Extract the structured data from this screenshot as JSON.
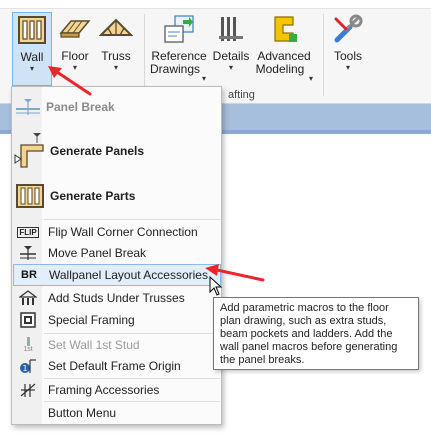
{
  "ribbon": {
    "buttons": [
      {
        "label": "Wall",
        "caret": "▾"
      },
      {
        "label": "Floor",
        "caret": "▾"
      },
      {
        "label": "Truss",
        "caret": "▾"
      },
      {
        "label": "Reference",
        "label2": "Drawings",
        "caret": "▾"
      },
      {
        "label": "Details",
        "caret": "▾"
      },
      {
        "label": "Advanced",
        "label2": "Modeling",
        "caret": "▾"
      },
      {
        "label": "Tools",
        "caret": "▾"
      }
    ],
    "group_label": "afting"
  },
  "menu": {
    "items": [
      {
        "label": "Panel Break",
        "icon": "panel-break-icon",
        "disabled": true
      },
      {
        "label": "Generate Panels",
        "icon": "generate-panels-icon"
      },
      {
        "label": "Generate Parts",
        "icon": "generate-parts-icon"
      },
      {
        "label": "Flip Wall Corner Connection",
        "icon": "flip-icon",
        "icon_text": "FLIP"
      },
      {
        "label": "Move Panel Break",
        "icon": "move-panel-break-icon"
      },
      {
        "label": "Wallpanel Layout Accessories",
        "icon": "br-icon",
        "icon_text": "BR"
      },
      {
        "label": "Add Studs Under Trusses",
        "icon": "studs-under-trusses-icon"
      },
      {
        "label": "Special Framing",
        "icon": "special-framing-icon"
      },
      {
        "label": "Set Wall 1st Stud",
        "icon": "first-stud-icon",
        "icon_text": "1st",
        "disabled": true
      },
      {
        "label": "Set Default Frame Origin",
        "icon": "frame-origin-icon"
      },
      {
        "label": "Framing Accessories",
        "icon": "framing-accessories-icon"
      },
      {
        "label": "Button Menu",
        "icon": ""
      }
    ]
  },
  "tooltip": {
    "text": "Add parametric macros to the floor plan drawing, such as extra studs, beam pockets and ladders. Add the wall panel macros before generating the panel breaks."
  },
  "colors": {
    "annotation_arrow": "#e8262b",
    "highlight": "#e2eefb",
    "ribbon_active": "#cfe3f7"
  }
}
